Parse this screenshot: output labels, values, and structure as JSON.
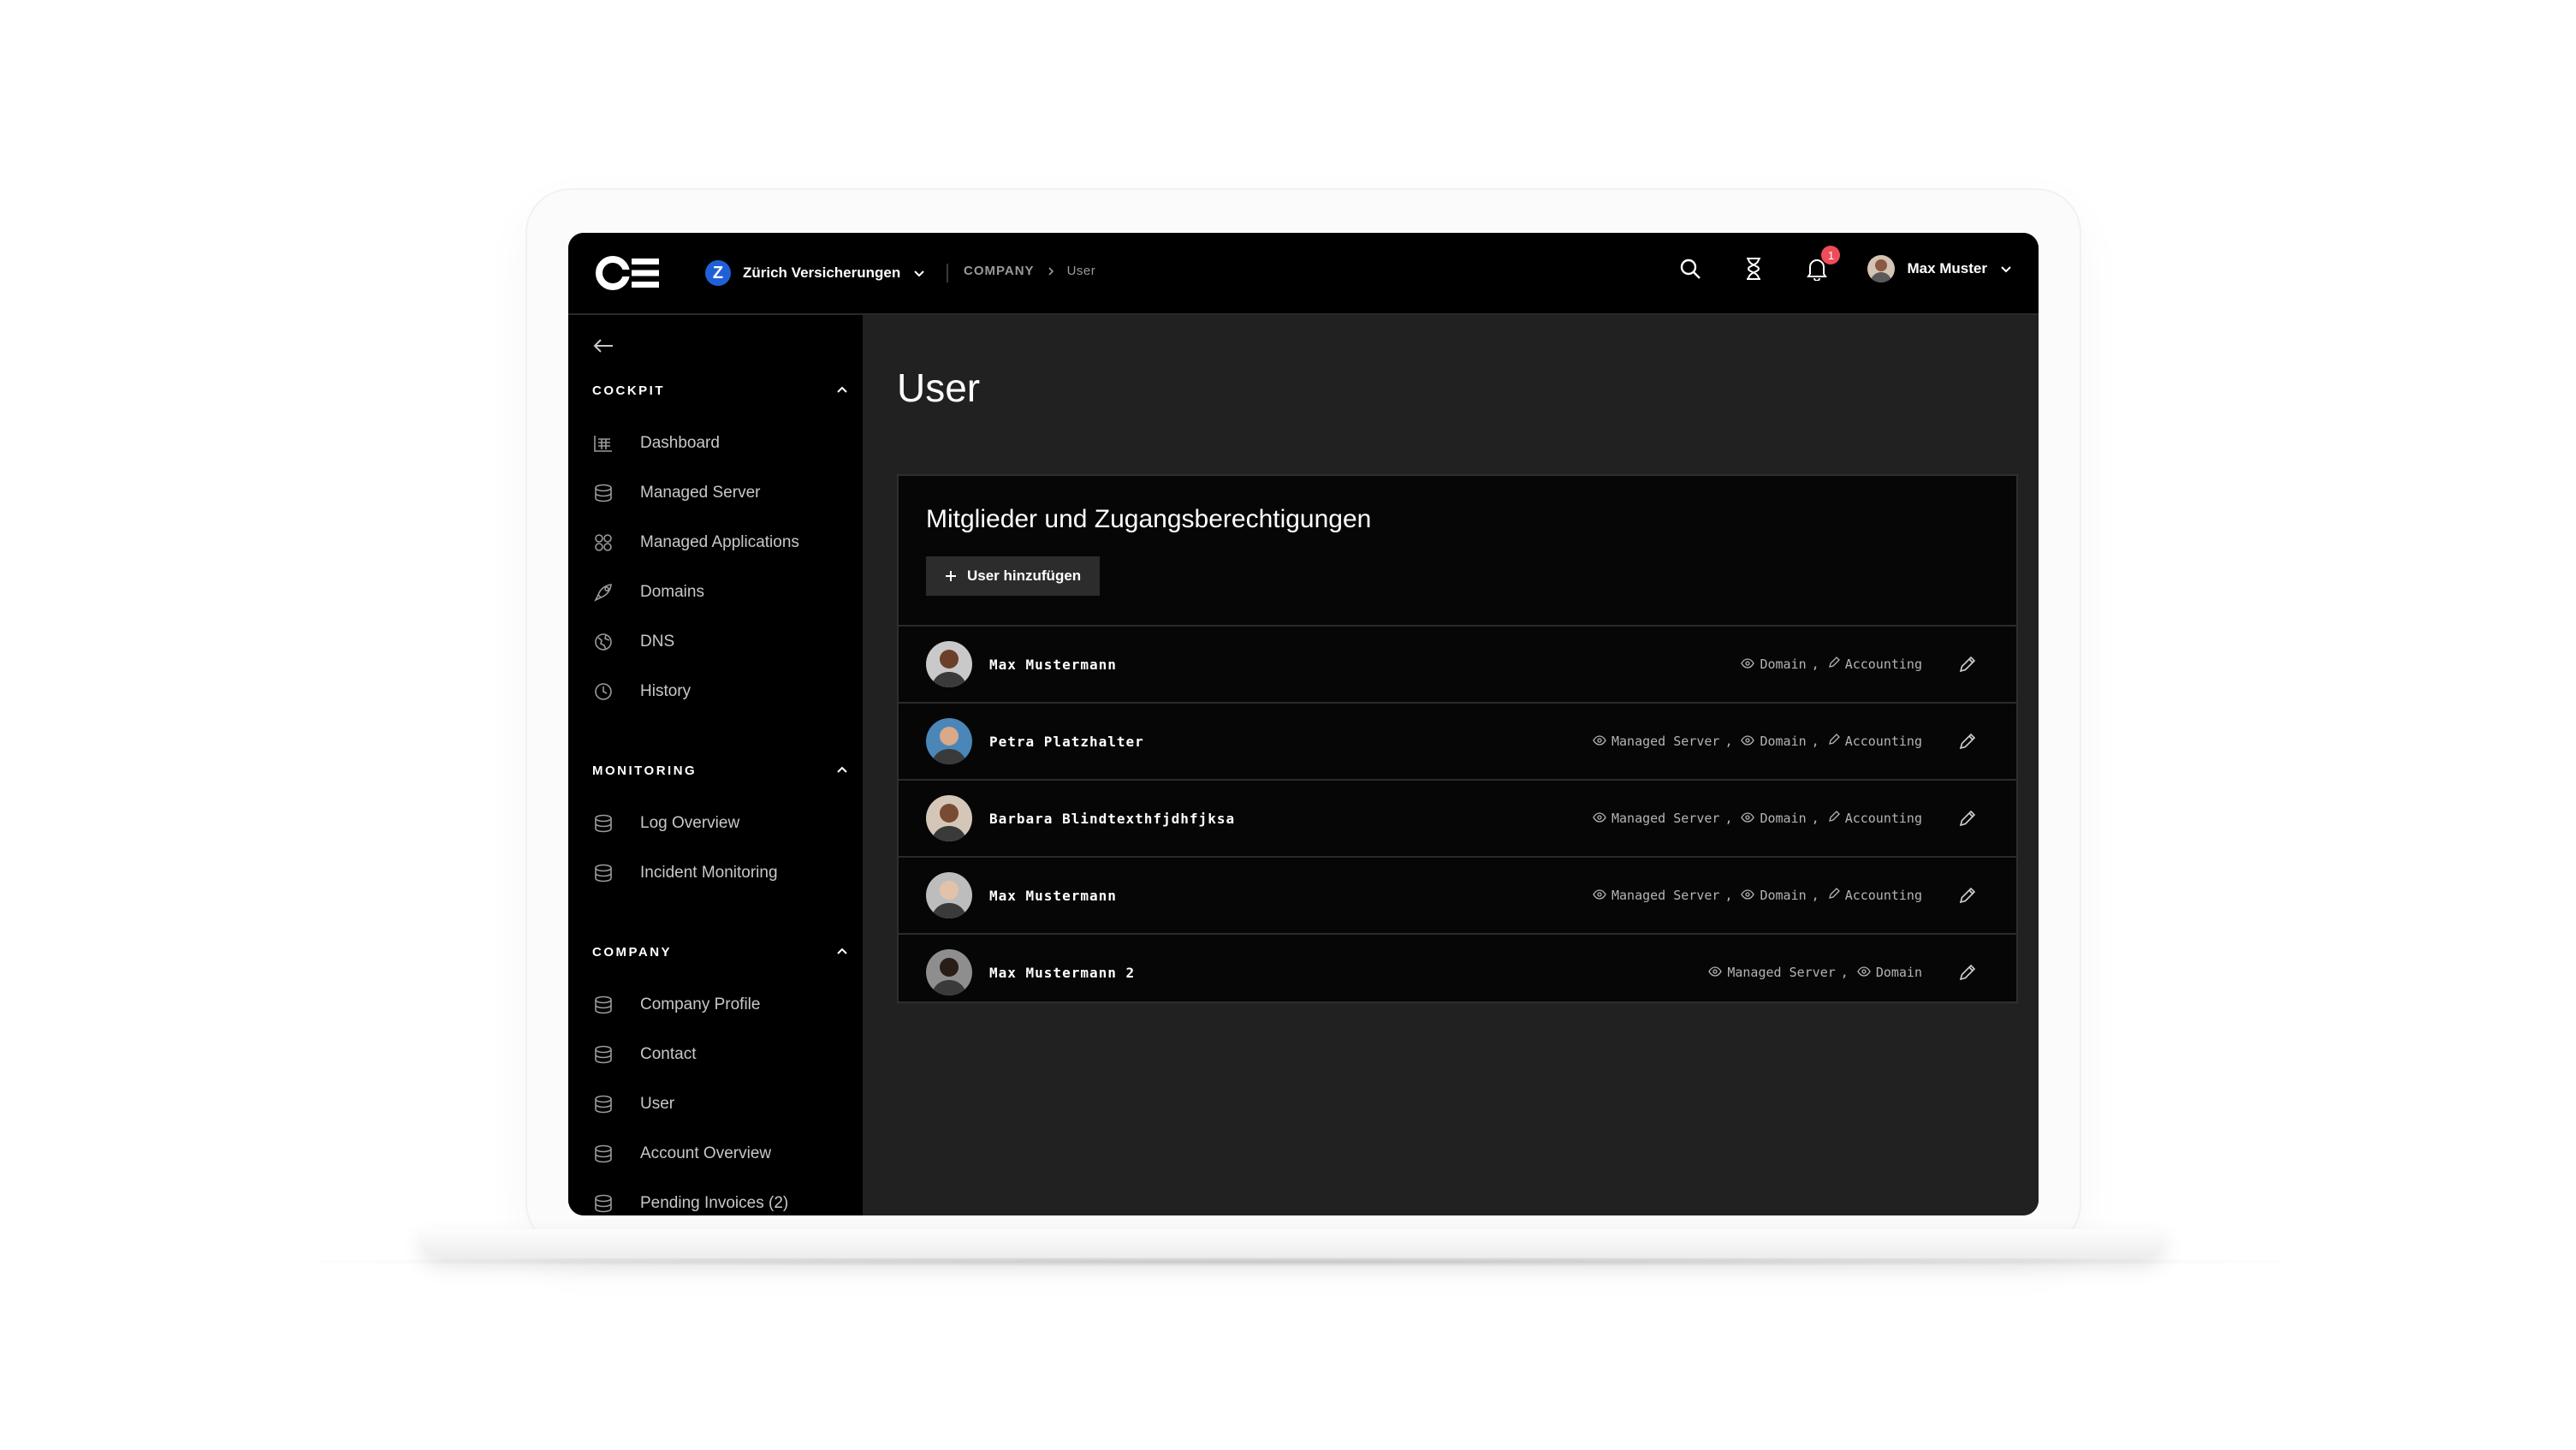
{
  "header": {
    "company": {
      "name": "Zürich Versicherungen",
      "logo_letter": "Z",
      "accent": "#1f60d6"
    },
    "breadcrumb": {
      "root": "COMPANY",
      "current": "User"
    },
    "notifications_count": "1",
    "user_name": "Max Muster",
    "icons": [
      "search-icon",
      "hourglass-icon",
      "bell-icon",
      "chevron-down-icon"
    ]
  },
  "sidebar": {
    "sections": [
      {
        "title": "COCKPIT",
        "items": [
          {
            "label": "Dashboard",
            "icon": "dashboard-icon"
          },
          {
            "label": "Managed Server",
            "icon": "database-icon"
          },
          {
            "label": "Managed Applications",
            "icon": "apps-icon"
          },
          {
            "label": "Domains",
            "icon": "rocket-icon"
          },
          {
            "label": "DNS",
            "icon": "globe-icon"
          },
          {
            "label": "History",
            "icon": "clock-icon"
          }
        ]
      },
      {
        "title": "MONITORING",
        "items": [
          {
            "label": "Log Overview",
            "icon": "database-icon"
          },
          {
            "label": "Incident Monitoring",
            "icon": "database-icon"
          }
        ]
      },
      {
        "title": "COMPANY",
        "items": [
          {
            "label": "Company Profile",
            "icon": "database-icon"
          },
          {
            "label": "Contact",
            "icon": "database-icon"
          },
          {
            "label": "User",
            "icon": "database-icon"
          },
          {
            "label": "Account Overview",
            "icon": "database-icon"
          },
          {
            "label": "Pending Invoices (2)",
            "icon": "database-icon"
          }
        ]
      }
    ]
  },
  "main": {
    "title": "User",
    "card": {
      "title": "Mitglieder und Zugangsberechtigungen",
      "add_button": "User hinzufügen",
      "users": [
        {
          "name": "Max Mustermann",
          "avatar_colors": [
            "#c9c9c9",
            "#6b3f2a"
          ],
          "perms": [
            {
              "type": "view",
              "label": "Domain",
              "suffix": ","
            },
            {
              "type": "edit",
              "label": "Accounting",
              "suffix": ""
            }
          ]
        },
        {
          "name": "Petra Platzhalter",
          "avatar_colors": [
            "#4a86b8",
            "#d9a98a"
          ],
          "perms": [
            {
              "type": "view",
              "label": "Managed Server",
              "suffix": ","
            },
            {
              "type": "view",
              "label": "Domain",
              "suffix": ","
            },
            {
              "type": "edit",
              "label": "Accounting",
              "suffix": ""
            }
          ]
        },
        {
          "name": "Barbara Blindtexthfjdhfjksa",
          "avatar_colors": [
            "#d5c7b8",
            "#7a4b33"
          ],
          "perms": [
            {
              "type": "view",
              "label": "Managed Server",
              "suffix": ","
            },
            {
              "type": "view",
              "label": "Domain",
              "suffix": ","
            },
            {
              "type": "edit",
              "label": "Accounting",
              "suffix": ""
            }
          ]
        },
        {
          "name": "Max Mustermann",
          "avatar_colors": [
            "#bdbdbd",
            "#e3c2aa"
          ],
          "perms": [
            {
              "type": "view",
              "label": "Managed Server",
              "suffix": ","
            },
            {
              "type": "view",
              "label": "Domain",
              "suffix": ","
            },
            {
              "type": "edit",
              "label": "Accounting",
              "suffix": ""
            }
          ]
        },
        {
          "name": "Max Mustermann 2",
          "avatar_colors": [
            "#8e8e8e",
            "#2a1d18"
          ],
          "perms": [
            {
              "type": "view",
              "label": "Managed Server",
              "suffix": ","
            },
            {
              "type": "view",
              "label": "Domain",
              "suffix": ""
            }
          ]
        }
      ]
    }
  }
}
